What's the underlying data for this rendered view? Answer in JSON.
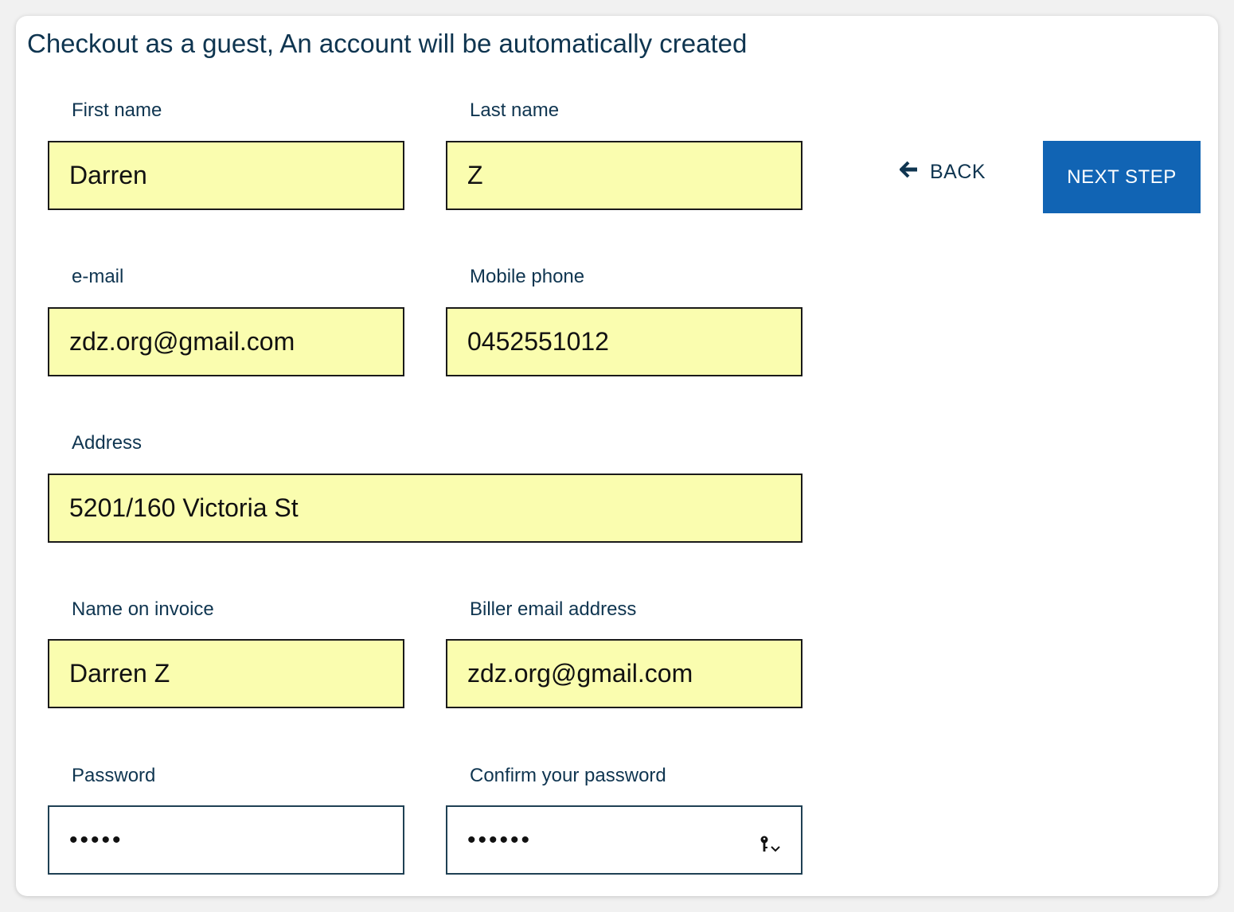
{
  "heading": "Checkout as a guest, An account will be automatically created",
  "fields": {
    "first_name": {
      "label": "First name",
      "value": "Darren"
    },
    "last_name": {
      "label": "Last name",
      "value": "Z"
    },
    "email": {
      "label": "e-mail",
      "value": "zdz.org@gmail.com"
    },
    "mobile_phone": {
      "label": "Mobile phone",
      "value": "0452551012"
    },
    "address": {
      "label": "Address",
      "value": "5201/160 Victoria St"
    },
    "name_on_invoice": {
      "label": "Name on invoice",
      "value": "Darren Z"
    },
    "biller_email": {
      "label": "Biller email address",
      "value": "zdz.org@gmail.com"
    },
    "password": {
      "label": "Password",
      "value": "•••••"
    },
    "confirm_password": {
      "label": "Confirm your password",
      "value": "••••••"
    }
  },
  "actions": {
    "back_label": "BACK",
    "next_label": "NEXT STEP"
  },
  "icons": {
    "back": "arrow-left-icon",
    "password_manager": "key-icon",
    "dropdown": "chevron-down-icon"
  },
  "colors": {
    "autofill_background": "#fafdaf",
    "primary_button": "#1164b4",
    "text_primary": "#0f3550"
  }
}
